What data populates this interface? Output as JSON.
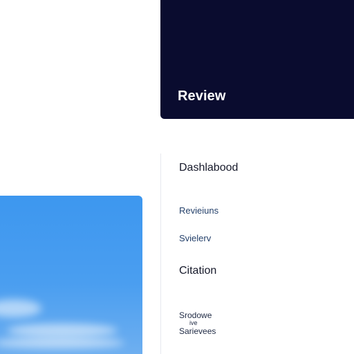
{
  "hero": {
    "title": "Review",
    "background": "#0a0c2f"
  },
  "nav": {
    "items": [
      {
        "label": "Dashlabood"
      },
      {
        "label": "Revieiuns"
      },
      {
        "label": "Svielerv"
      },
      {
        "label": "Citation"
      }
    ],
    "footer": {
      "line1": "Srodowe",
      "line2": "ive",
      "line3": "Sarievees"
    }
  },
  "image_tile": {
    "accent": "#3d97ef"
  }
}
